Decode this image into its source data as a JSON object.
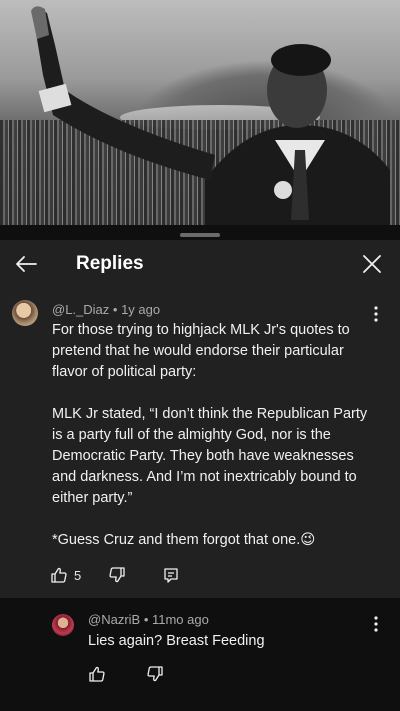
{
  "header": {
    "title": "Replies"
  },
  "comments": [
    {
      "author": "@L._Diaz",
      "time": "1y ago",
      "text": "For those trying to highjack MLK Jr's quotes to pretend that he would endorse their particular flavor of political party:\n\nMLK Jr stated, “I don’t think the Republican Party is a party full of the almighty God, nor is the Democratic Party. They both have weaknesses and darkness. And I’m not inextricably bound to either party.”\n\n*Guess Cruz and them forgot that one.😉",
      "likes": "5"
    },
    {
      "author": "@NazriB",
      "time": "11mo ago",
      "text": "Lies again? Breast Feeding"
    }
  ],
  "meta_separator": " • ",
  "icons": {
    "back": "arrow-left-icon",
    "close": "close-icon",
    "more": "more-vertical-icon",
    "like": "thumbs-up-icon",
    "dislike": "thumbs-down-icon",
    "reply": "reply-icon"
  }
}
